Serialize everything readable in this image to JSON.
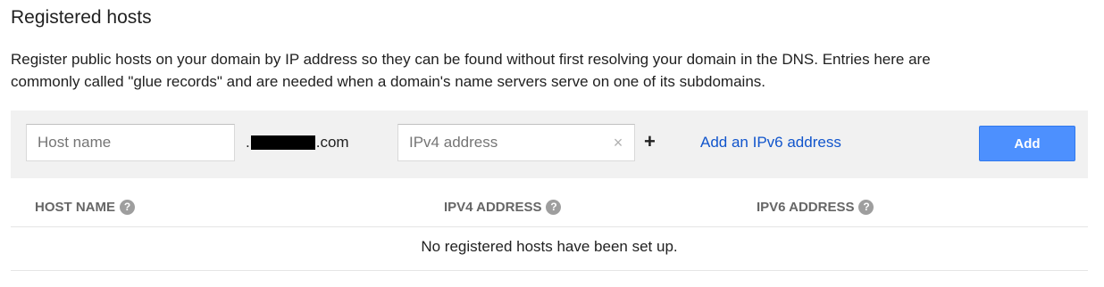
{
  "section": {
    "title": "Registered hosts",
    "description_line1": "Register public hosts on your domain by IP address so they can be found without first resolving your domain in the DNS. Entries here are",
    "description_line2": "commonly called \"glue records\" and are needed when a domain's name servers serve on one of its subdomains."
  },
  "form": {
    "host_placeholder": "Host name",
    "host_value": "",
    "domain_prefix": ".",
    "domain_suffix": ".com",
    "ipv4_placeholder": "IPv4 address",
    "ipv4_value": "",
    "clear_glyph": "×",
    "plus_glyph": "+",
    "add_ipv6_link": "Add an IPv6 address",
    "add_button_label": "Add"
  },
  "table": {
    "columns": [
      {
        "label": "HOST NAME"
      },
      {
        "label": "IPV4 ADDRESS"
      },
      {
        "label": "IPV6 ADDRESS"
      }
    ],
    "help_glyph": "?",
    "empty_message": "No registered hosts have been set up."
  },
  "icons": {
    "clear": "clear-icon",
    "plus": "plus-icon",
    "help": "help-icon"
  },
  "colors": {
    "accent": "#4d90fe",
    "link": "#1155cc",
    "bar_background": "#f1f1f1",
    "header_text": "#666666"
  }
}
